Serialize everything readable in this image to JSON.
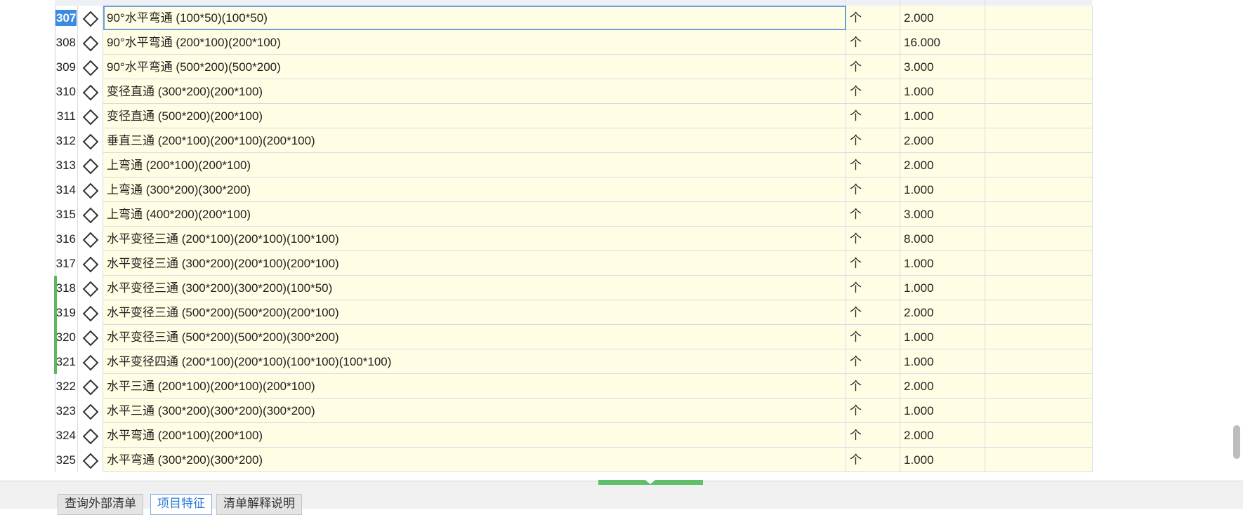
{
  "rows": [
    {
      "num": "307",
      "name": "90°水平弯通 (100*50)(100*50)",
      "unit": "个",
      "qty": "2.000"
    },
    {
      "num": "308",
      "name": "90°水平弯通 (200*100)(200*100)",
      "unit": "个",
      "qty": "16.000"
    },
    {
      "num": "309",
      "name": "90°水平弯通 (500*200)(500*200)",
      "unit": "个",
      "qty": "3.000"
    },
    {
      "num": "310",
      "name": "变径直通 (300*200)(200*100)",
      "unit": "个",
      "qty": "1.000"
    },
    {
      "num": "311",
      "name": "变径直通 (500*200)(200*100)",
      "unit": "个",
      "qty": "1.000"
    },
    {
      "num": "312",
      "name": "垂直三通 (200*100)(200*100)(200*100)",
      "unit": "个",
      "qty": "2.000"
    },
    {
      "num": "313",
      "name": "上弯通 (200*100)(200*100)",
      "unit": "个",
      "qty": "2.000"
    },
    {
      "num": "314",
      "name": "上弯通 (300*200)(300*200)",
      "unit": "个",
      "qty": "1.000"
    },
    {
      "num": "315",
      "name": "上弯通 (400*200)(200*100)",
      "unit": "个",
      "qty": "3.000"
    },
    {
      "num": "316",
      "name": "水平变径三通 (200*100)(200*100)(100*100)",
      "unit": "个",
      "qty": "8.000"
    },
    {
      "num": "317",
      "name": "水平变径三通 (300*200)(200*100)(200*100)",
      "unit": "个",
      "qty": "1.000"
    },
    {
      "num": "318",
      "name": "水平变径三通 (300*200)(300*200)(100*50)",
      "unit": "个",
      "qty": "1.000"
    },
    {
      "num": "319",
      "name": "水平变径三通 (500*200)(500*200)(200*100)",
      "unit": "个",
      "qty": "2.000"
    },
    {
      "num": "320",
      "name": "水平变径三通 (500*200)(500*200)(300*200)",
      "unit": "个",
      "qty": "1.000"
    },
    {
      "num": "321",
      "name": "水平变径四通 (200*100)(200*100)(100*100)(100*100)",
      "unit": "个",
      "qty": "1.000"
    },
    {
      "num": "322",
      "name": "水平三通 (200*100)(200*100)(200*100)",
      "unit": "个",
      "qty": "2.000"
    },
    {
      "num": "323",
      "name": "水平三通 (300*200)(300*200)(300*200)",
      "unit": "个",
      "qty": "1.000"
    },
    {
      "num": "324",
      "name": "水平弯通 (200*100)(200*100)",
      "unit": "个",
      "qty": "2.000"
    },
    {
      "num": "325",
      "name": "水平弯通 (300*200)(300*200)",
      "unit": "个",
      "qty": "1.000"
    }
  ],
  "selected_row": "307",
  "modified_rows": [
    "318",
    "319",
    "320",
    "321"
  ],
  "tabs": [
    {
      "label": "查询外部清单",
      "active": false
    },
    {
      "label": "项目特征",
      "active": true
    },
    {
      "label": "清单解释说明",
      "active": false
    }
  ],
  "colors": {
    "row_bg": "#fffde3",
    "selected_num_bg": "#3d8be0",
    "modified_marker": "#5cb85c",
    "active_tab_text": "#2b7bd6"
  }
}
